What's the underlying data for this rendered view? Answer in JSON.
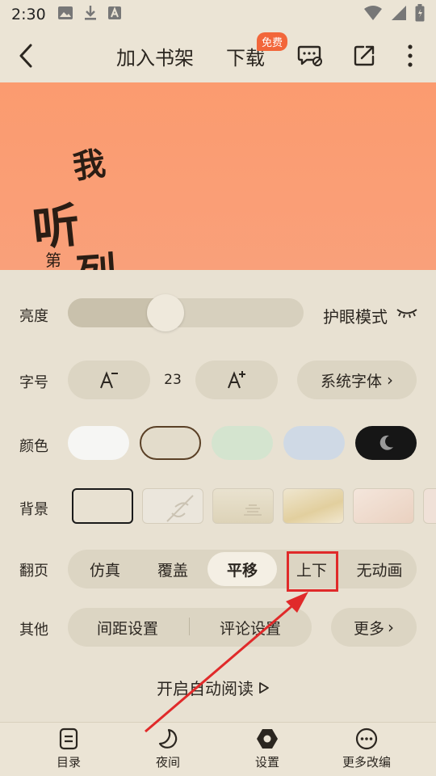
{
  "status_bar": {
    "time": "2:30"
  },
  "toolbar": {
    "add_shelf": "加入书架",
    "download": "下载",
    "free_badge": "免费"
  },
  "cover": {
    "glyph_1": "我",
    "glyph_2": "听",
    "glyph_3": "第",
    "glyph_4": "列"
  },
  "settings": {
    "brightness": {
      "label": "亮度",
      "level_percent": 40,
      "eye_mode": "护眼模式"
    },
    "font": {
      "label": "字号",
      "size": "23",
      "font_name": "系统字体",
      "font_chevron": "›"
    },
    "color": {
      "label": "颜色",
      "options": [
        "#f6f6f4",
        "#e3dccb",
        "#d4e4cf",
        "#cfd9e5",
        "#161616"
      ],
      "selected_index": 1
    },
    "background": {
      "label": "背景",
      "selected_index": 0
    },
    "page_turn": {
      "label": "翻页",
      "options": [
        "仿真",
        "覆盖",
        "平移",
        "上下",
        "无动画"
      ],
      "selected": "平移"
    },
    "other": {
      "label": "其他",
      "spacing": "间距设置",
      "comment": "评论设置",
      "more": "更多",
      "more_chevron": "›"
    },
    "auto_read": "开启自动阅读"
  },
  "bottom_nav": [
    {
      "label": "目录",
      "icon": "catalog-icon"
    },
    {
      "label": "夜间",
      "icon": "moon-icon"
    },
    {
      "label": "设置",
      "icon": "settings-hex-icon"
    },
    {
      "label": "更多改编",
      "icon": "more-circle-icon"
    }
  ],
  "colors": {
    "annotation_red": "#e02a2a",
    "accent_orange": "#f2663a"
  }
}
